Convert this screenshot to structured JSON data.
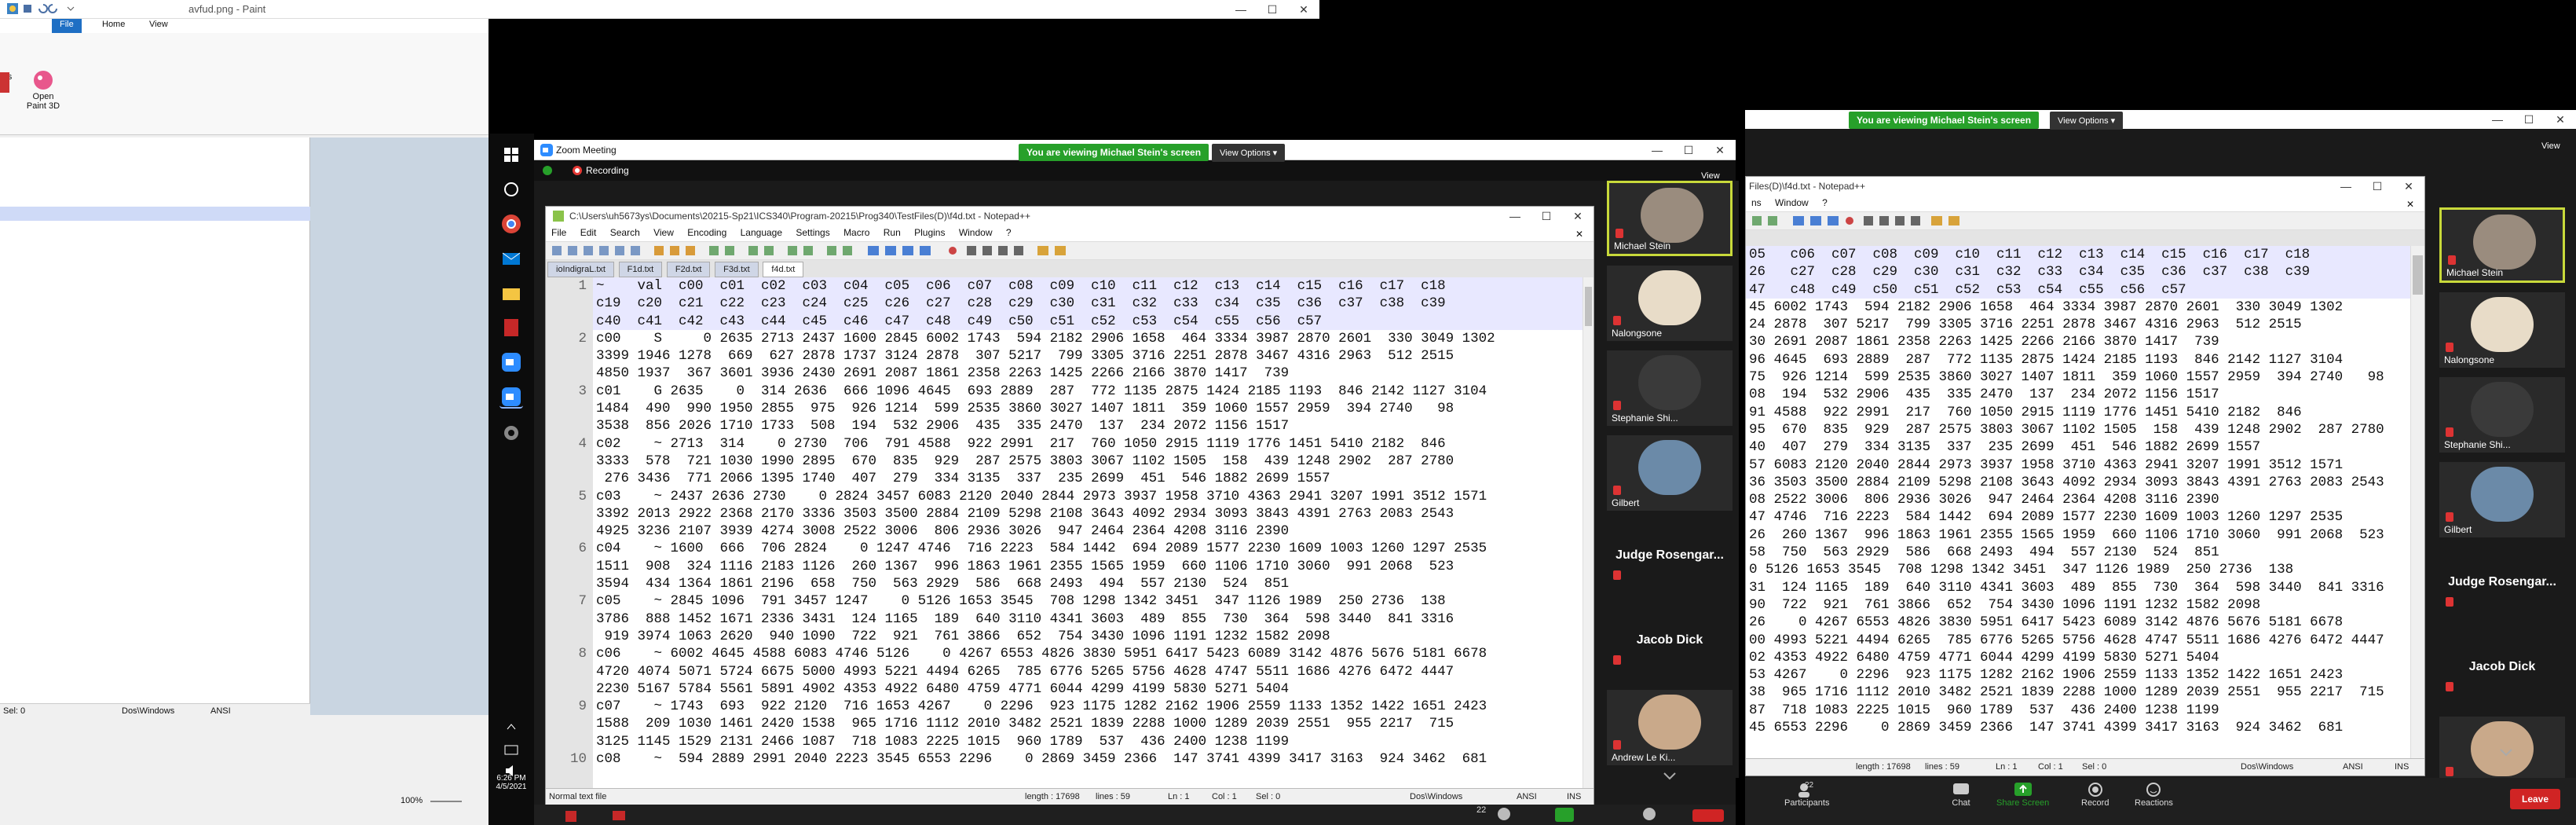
{
  "paint": {
    "title": "avfud.png - Paint",
    "tabs": [
      "File",
      "Home",
      "View"
    ],
    "open_paint3d": "Open\nPaint 3D",
    "ribbon_left": "ors",
    "status_sel": "Sel: 0",
    "status_enc": "Dos\\Windows",
    "status_ansi": "ANSI",
    "zoom": "100%"
  },
  "taskbar": {
    "time": "6:26 PM",
    "date": "4/5/2021"
  },
  "zoom_main": {
    "title": "Zoom Meeting",
    "recording": "Recording",
    "banner": "You are viewing Michael Stein's screen",
    "view_options": "View Options",
    "view_label": "View",
    "participants": [
      {
        "name": "Michael Stein",
        "type": "video",
        "active": true
      },
      {
        "name": "Nalongsone",
        "type": "video"
      },
      {
        "name": "Stephanie Shi...",
        "type": "video"
      },
      {
        "name": "Gilbert",
        "type": "video"
      },
      {
        "name": "Judge  Rosengar...",
        "type": "name"
      },
      {
        "name": "Jacob Dick",
        "type": "name"
      },
      {
        "name": "Andrew Le Ki...",
        "type": "video"
      }
    ],
    "toolbar": {
      "participants_count": "22",
      "chat": "",
      "share": "",
      "record": "",
      "reactions": ""
    }
  },
  "npp_main": {
    "title": "C:\\Users\\uh5673ys\\Documents\\20215-Sp21\\ICS340\\Program-20215\\Prog340\\TestFiles(D)\\f4d.txt - Notepad++",
    "menu": [
      "File",
      "Edit",
      "Search",
      "View",
      "Encoding",
      "Language",
      "Settings",
      "Macro",
      "Run",
      "Plugins",
      "Window",
      "?"
    ],
    "tabs": [
      "ioIndigraL.txt",
      "F1d.txt",
      "F2d.txt",
      "F3d.txt",
      "f4d.txt"
    ],
    "line_numbers": [
      "1",
      "",
      "",
      "2",
      "",
      "",
      "3",
      "",
      "",
      "4",
      "",
      "",
      "5",
      "",
      "",
      "6",
      "",
      "",
      "7",
      "",
      "",
      "8",
      "",
      "",
      "9",
      "",
      "",
      "10"
    ],
    "lines": [
      "~    val  c00  c01  c02  c03  c04  c05  c06  c07  c08  c09  c10  c11  c12  c13  c14  c15  c16  c17  c18",
      "c19  c20  c21  c22  c23  c24  c25  c26  c27  c28  c29  c30  c31  c32  c33  c34  c35  c36  c37  c38  c39",
      "c40  c41  c42  c43  c44  c45  c46  c47  c48  c49  c50  c51  c52  c53  c54  c55  c56  c57",
      "c00    S     0 2635 2713 2437 1600 2845 6002 1743  594 2182 2906 1658  464 3334 3987 2870 2601  330 3049 1302",
      "3399 1946 1278  669  627 2878 1737 3124 2878  307 5217  799 3305 3716 2251 2878 3467 4316 2963  512 2515",
      "4850 1937  367 3601 3936 2430 2691 2087 1861 2358 2263 1425 2266 2166 3870 1417  739",
      "c01    G 2635    0  314 2636  666 1096 4645  693 2889  287  772 1135 2875 1424 2185 1193  846 2142 1127 3104",
      "1484  490  990 1950 2855  975  926 1214  599 2535 3860 3027 1407 1811  359 1060 1557 2959  394 2740   98",
      "3538  856 2026 1710 1733  508  194  532 2906  435  335 2470  137  234 2072 1156 1517",
      "c02    ~ 2713  314    0 2730  706  791 4588  922 2991  217  760 1050 2915 1119 1776 1451 5410 2182  846",
      "3333  578  721 1030 1990 2895  670  835  929  287 2575 3803 3067 1102 1505  158  439 1248 2902  287 2780",
      " 276 3436  771 2066 1395 1740  407  279  334 3135  337  235 2699  451  546 1882 2699 1557",
      "c03    ~ 2437 2636 2730    0 2824 3457 6083 2120 2040 2844 2973 3937 1958 3710 4363 2941 3207 1991 3512 1571",
      "3392 2013 2922 2368 2170 3336 3503 3500 2884 2109 5298 2108 3643 4092 2934 3093 3843 4391 2763 2083 2543",
      "4925 3236 2107 3939 4274 3008 2522 3006  806 2936 3026  947 2464 2364 4208 3116 2390",
      "c04    ~ 1600  666  706 2824    0 1247 4746  716 2223  584 1442  694 2089 1577 2230 1609 1003 1260 1297 2535",
      "1511  908  324 1116 2183 1126  260 1367  996 1863 1961 2355 1565 1959  660 1106 1710 3060  991 2068  523",
      "3594  434 1364 1861 2196  658  750  563 2929  586  668 2493  494  557 2130  524  851",
      "c05    ~ 2845 1096  791 3457 1247    0 5126 1653 3545  708 1298 1342 3451  347 1126 1989  250 2736  138",
      "3786  888 1452 1671 2336 3431  124 1165  189  640 3110 4341 3603  489  855  730  364  598 3440  841 3316",
      " 919 3974 1063 2620  940 1090  722  921  761 3866  652  754 3430 1096 1191 1232 1582 2098",
      "c06    ~ 6002 4645 4588 6083 4746 5126    0 4267 6553 4826 3830 5951 6417 5423 6089 3142 4876 5676 5181 6678",
      "4720 4074 5071 5724 6675 5000 4993 5221 4494 6265  785 6776 5265 5756 4628 4747 5511 1686 4276 6472 4447",
      "2230 5167 5784 5561 5891 4902 4353 4922 6480 4759 4771 6044 4299 4199 5830 5271 5404",
      "c07    ~ 1743  693  922 2120  716 1653 4267    0 2296  923 1175 1282 2162 1906 2559 1133 1352 1422 1651 2423",
      "1588  209 1030 1461 2420 1538  965 1716 1112 2010 3482 2521 1839 2288 1000 1289 2039 2551  955 2217  715",
      "3125 1145 1529 2131 2466 1087  718 1083 2225 1015  960 1789  537  436 2400 1238 1199",
      "c08    ~  594 2889 2991 2040 2223 3545 6553 2296    0 2869 3459 2366  147 3741 4399 3417 3163  924 3462  681"
    ],
    "status": {
      "type": "Normal text file",
      "length": "length : 17698",
      "lines": "lines : 59",
      "pos": "Ln : 1",
      "col": "Col : 1",
      "sel": "Sel : 0",
      "eol": "Dos\\Windows",
      "enc": "ANSI",
      "mode": "INS"
    }
  },
  "zoom_right": {
    "banner": "You are viewing Michael Stein's screen",
    "view_options": "View Options",
    "view_label": "View",
    "npp_title": "Files(D)\\f4d.txt - Notepad++",
    "menu": [
      "ns",
      "Window",
      "?"
    ],
    "lines": [
      "05   c06  c07  c08  c09  c10  c11  c12  c13  c14  c15  c16  c17  c18",
      "26   c27  c28  c29  c30  c31  c32  c33  c34  c35  c36  c37  c38  c39",
      "47   c48  c49  c50  c51  c52  c53  c54  c55  c56  c57",
      "45 6002 1743  594 2182 2906 1658  464 3334 3987 2870 2601  330 3049 1302",
      "24 2878  307 5217  799 3305 3716 2251 2878 3467 4316 2963  512 2515",
      "30 2691 2087 1861 2358 2263 1425 2266 2166 3870 1417  739",
      "96 4645  693 2889  287  772 1135 2875 1424 2185 1193  846 2142 1127 3104",
      "75  926 1214  599 2535 3860 3027 1407 1811  359 1060 1557 2959  394 2740   98",
      "08  194  532 2906  435  335 2470  137  234 2072 1156 1517",
      "91 4588  922 2991  217  760 1050 2915 1119 1776 1451 5410 2182  846",
      "95  670  835  929  287 2575 3803 3067 1102 1505  158  439 1248 2902  287 2780",
      "40  407  279  334 3135  337  235 2699  451  546 1882 2699 1557",
      "57 6083 2120 2040 2844 2973 3937 1958 3710 4363 2941 3207 1991 3512 1571",
      "36 3503 3500 2884 2109 5298 2108 3643 4092 2934 3093 3843 4391 2763 2083 2543",
      "08 2522 3006  806 2936 3026  947 2464 2364 4208 3116 2390",
      "47 4746  716 2223  584 1442  694 2089 1577 2230 1609 1003 1260 1297 2535",
      "26  260 1367  996 1863 1961 2355 1565 1959  660 1106 1710 3060  991 2068  523",
      "58  750  563 2929  586  668 2493  494  557 2130  524  851",
      "0 5126 1653 3545  708 1298 1342 3451  347 1126 1989  250 2736  138",
      "31  124 1165  189  640 3110 4341 3603  489  855  730  364  598 3440  841 3316",
      "90  722  921  761 3866  652  754 3430 1096 1191 1232 1582 2098",
      "26    0 4267 6553 4826 3830 5951 6417 5423 6089 3142 4876 5676 5181 6678",
      "00 4993 5221 4494 6265  785 6776 5265 5756 4628 4747 5511 1686 4276 6472 4447",
      "02 4353 4922 6480 4759 4771 6044 4299 4199 5830 5271 5404",
      "53 4267    0 2296  923 1175 1282 2162 1906 2559 1133 1352 1422 1651 2423",
      "38  965 1716 1112 2010 3482 2521 1839 2288 1000 1289 2039 2551  955 2217  715",
      "87  718 1083 2225 1015  960 1789  537  436 2400 1238 1199",
      "45 6553 2296    0 2869 3459 2366  147 3741 4399 3417 3163  924 3462  681"
    ],
    "status": {
      "length": "length : 17698",
      "lines": "lines : 59",
      "pos": "Ln : 1",
      "col": "Col : 1",
      "sel": "Sel : 0",
      "eol": "Dos\\Windows",
      "enc": "ANSI",
      "mode": "INS"
    },
    "participants": [
      {
        "name": "Michael Stein",
        "type": "video",
        "active": true
      },
      {
        "name": "Nalongsone",
        "type": "video"
      },
      {
        "name": "Stephanie Shi...",
        "type": "video"
      },
      {
        "name": "Gilbert",
        "type": "video"
      },
      {
        "name": "Judge  Rosengar...",
        "type": "name"
      },
      {
        "name": "Jacob Dick",
        "type": "name"
      },
      {
        "name": "Andrew Le Ki...",
        "type": "video"
      }
    ],
    "toolbar": {
      "participants_count": "22",
      "participants": "Participants",
      "chat": "Chat",
      "share": "Share Screen",
      "record": "Record",
      "reactions": "Reactions",
      "leave": "Leave"
    }
  }
}
